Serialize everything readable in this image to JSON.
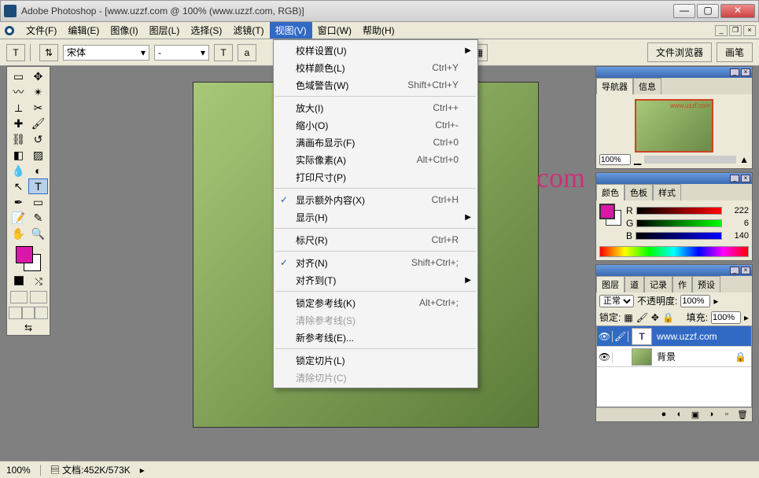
{
  "title": "Adobe Photoshop - [www.uzzf.com @ 100% (www.uzzf.com, RGB)]",
  "menus": [
    "文件(F)",
    "编辑(E)",
    "图像(I)",
    "图层(L)",
    "选择(S)",
    "滤镜(T)",
    "视图(V)",
    "窗口(W)",
    "帮助(H)"
  ],
  "options": {
    "tool_letter": "T",
    "font": "宋体",
    "size_placeholder": "-",
    "color": "#d818a8",
    "tab1": "文件浏览器",
    "tab2": "画笔"
  },
  "canvas": {
    "text": "com"
  },
  "dropdown": {
    "items": [
      {
        "label": "校样设置(U)",
        "shortcut": "",
        "sub": true
      },
      {
        "label": "校样颜色(L)",
        "shortcut": "Ctrl+Y"
      },
      {
        "label": "色域警告(W)",
        "shortcut": "Shift+Ctrl+Y"
      },
      {
        "sep": true
      },
      {
        "label": "放大(I)",
        "shortcut": "Ctrl++"
      },
      {
        "label": "缩小(O)",
        "shortcut": "Ctrl+-"
      },
      {
        "label": "满画布显示(F)",
        "shortcut": "Ctrl+0"
      },
      {
        "label": "实际像素(A)",
        "shortcut": "Alt+Ctrl+0"
      },
      {
        "label": "打印尺寸(P)",
        "shortcut": ""
      },
      {
        "sep": true
      },
      {
        "label": "显示额外内容(X)",
        "shortcut": "Ctrl+H",
        "checked": true
      },
      {
        "label": "显示(H)",
        "shortcut": "",
        "sub": true
      },
      {
        "sep": true
      },
      {
        "label": "标尺(R)",
        "shortcut": "Ctrl+R"
      },
      {
        "sep": true
      },
      {
        "label": "对齐(N)",
        "shortcut": "Shift+Ctrl+;",
        "checked": true
      },
      {
        "label": "对齐到(T)",
        "shortcut": "",
        "sub": true
      },
      {
        "sep": true
      },
      {
        "label": "锁定参考线(K)",
        "shortcut": "Alt+Ctrl+;"
      },
      {
        "label": "清除参考线(S)",
        "shortcut": "",
        "disabled": true
      },
      {
        "label": "新参考线(E)...",
        "shortcut": ""
      },
      {
        "sep": true
      },
      {
        "label": "锁定切片(L)",
        "shortcut": ""
      },
      {
        "label": "清除切片(C)",
        "shortcut": "",
        "disabled": true
      }
    ]
  },
  "navigator": {
    "tabs": [
      "导航器",
      "信息"
    ],
    "preview_text": "www.uzzf.com",
    "zoom": "100%"
  },
  "color_panel": {
    "tabs": [
      "颜色",
      "色板",
      "样式"
    ],
    "swatch": "#d818a8",
    "channels": [
      {
        "name": "R",
        "value": 222,
        "grad": "linear-gradient(90deg,#000,#f00)"
      },
      {
        "name": "G",
        "value": 6,
        "grad": "linear-gradient(90deg,#000,#0f0)"
      },
      {
        "name": "B",
        "value": 140,
        "grad": "linear-gradient(90deg,#000,#00f)"
      }
    ]
  },
  "layers_panel": {
    "tabs": [
      "图层",
      "道",
      "记录",
      "作",
      "预设"
    ],
    "blend": "正常",
    "opacity_label": "不透明度:",
    "opacity": "100%",
    "lock_label": "锁定:",
    "fill_label": "填充:",
    "fill": "100%",
    "layers": [
      {
        "name": "www.uzzf.com",
        "type": "T",
        "selected": true
      },
      {
        "name": "背景",
        "type": "bg",
        "locked": true
      }
    ]
  },
  "status": {
    "zoom": "100%",
    "doc": "文档:452K/573K"
  },
  "colors": {
    "fg": "#d818a8"
  }
}
